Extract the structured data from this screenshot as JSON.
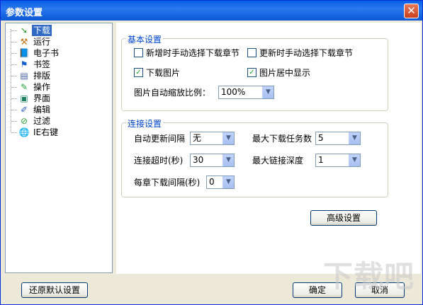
{
  "window": {
    "title": "参数设置",
    "close_glyph": "✕"
  },
  "tree": {
    "items": [
      {
        "label": "下载",
        "icon": "download-arrow-icon",
        "glyph": "➘",
        "color": "#2a9a2a",
        "selected": true
      },
      {
        "label": "运行",
        "icon": "hammer-icon",
        "glyph": "⚒",
        "color": "#c07010"
      },
      {
        "label": "电子书",
        "icon": "book-icon",
        "glyph": "📘",
        "color": "#2050c0"
      },
      {
        "label": "书签",
        "icon": "flag-icon",
        "glyph": "⚑",
        "color": "#1060d0"
      },
      {
        "label": "排版",
        "icon": "layout-icon",
        "glyph": "▤",
        "color": "#4060a0"
      },
      {
        "label": "操作",
        "icon": "operation-icon",
        "glyph": "✎",
        "color": "#20a040"
      },
      {
        "label": "界面",
        "icon": "window-icon",
        "glyph": "▣",
        "color": "#208060"
      },
      {
        "label": "编辑",
        "icon": "edit-icon",
        "glyph": "✐",
        "color": "#3060c0"
      },
      {
        "label": "过滤",
        "icon": "filter-icon",
        "glyph": "⊘",
        "color": "#30a030"
      },
      {
        "label": "IE右键",
        "icon": "globe-icon",
        "glyph": "🌐",
        "color": "#2a8a2a"
      }
    ]
  },
  "basic": {
    "title": "基本设置",
    "check_manual_add": {
      "label": "新增时手动选择下载章节",
      "checked": false
    },
    "check_manual_update": {
      "label": "更新时手动选择下载章节",
      "checked": false
    },
    "check_download_images": {
      "label": "下载图片",
      "checked": true
    },
    "check_center_images": {
      "label": "图片居中显示",
      "checked": true
    },
    "zoom_label": "图片自动缩放比例：",
    "zoom_value": "100%"
  },
  "connection": {
    "title": "连接设置",
    "auto_update_label": "自动更新间隔",
    "auto_update_value": "无",
    "max_tasks_label": "最大下载任务数",
    "max_tasks_value": "5",
    "timeout_label": "连接超时(秒)",
    "timeout_value": "30",
    "max_depth_label": "最大链接深度",
    "max_depth_value": "1",
    "chapter_interval_label": "每章下载间隔(秒)",
    "chapter_interval_value": "0"
  },
  "buttons": {
    "advanced": "高级设置",
    "restore_defaults": "还原默认设置",
    "ok": "确定",
    "cancel": "取消"
  },
  "check_glyph": "✓",
  "dropdown_glyph": "▼",
  "watermark": "下载吧"
}
